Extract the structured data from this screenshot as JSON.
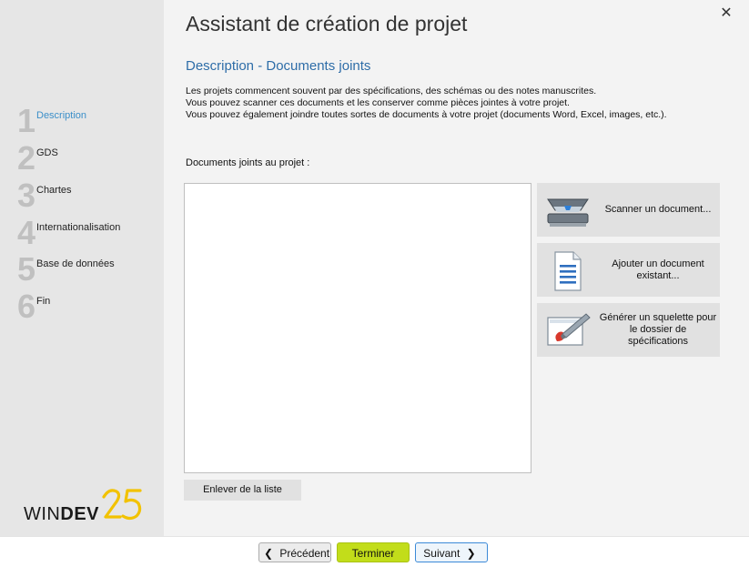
{
  "wizard": {
    "title": "Assistant de création de projet",
    "close_glyph": "✕"
  },
  "steps": [
    {
      "num": "1",
      "label": "Description",
      "active": true
    },
    {
      "num": "2",
      "label": "GDS"
    },
    {
      "num": "3",
      "label": "Chartes"
    },
    {
      "num": "4",
      "label": "Internationalisation"
    },
    {
      "num": "5",
      "label": "Base de données"
    },
    {
      "num": "6",
      "label": "Fin"
    }
  ],
  "logo": {
    "word_prefix": "WIN",
    "word_bold": "DEV",
    "version": "25",
    "accent": "#f2c200"
  },
  "section": {
    "subtitle": "Description - Documents joints",
    "lines": [
      "Les projets commencent souvent par des spécifications, des schémas ou des notes manuscrites.",
      "Vous pouvez scanner ces documents et les conserver comme pièces jointes à votre projet.",
      "Vous pouvez également joindre toutes sortes de documents à votre projet (documents Word, Excel, images, etc.)."
    ],
    "list_label": "Documents joints au projet :",
    "remove_label": "Enlever de la liste"
  },
  "actions": [
    {
      "icon": "scanner-icon",
      "label": "Scanner un document..."
    },
    {
      "icon": "document-icon",
      "label": "Ajouter un document existant..."
    },
    {
      "icon": "paint-brush-icon",
      "label": "Générer un squelette pour le dossier de spécifications"
    }
  ],
  "footer": {
    "prev_label": "Précédent",
    "finish_label": "Terminer",
    "next_label": "Suivant",
    "prev_glyph": "❮",
    "next_glyph": "❯"
  }
}
